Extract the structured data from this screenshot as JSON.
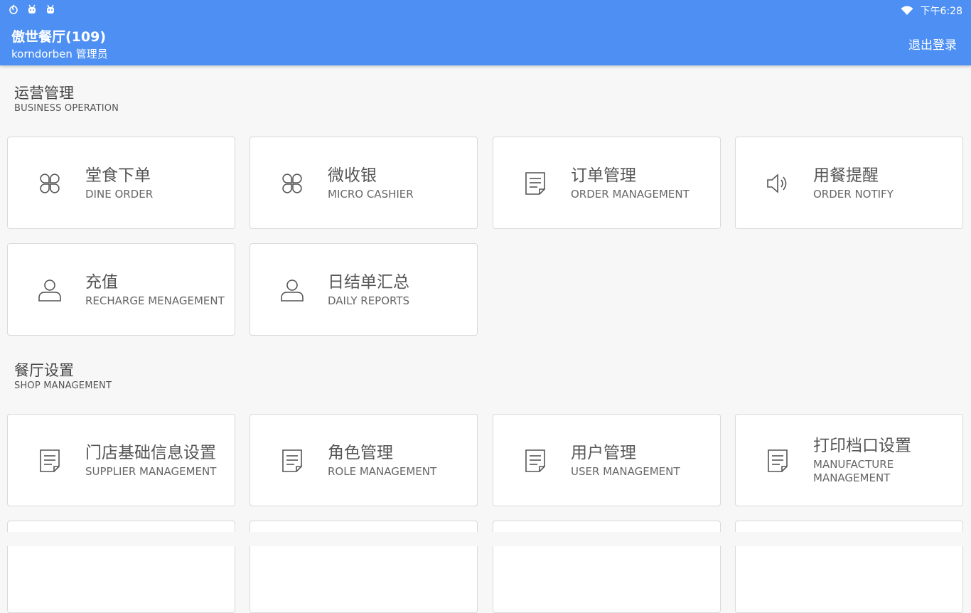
{
  "status_bar": {
    "time": "下午6:28"
  },
  "header": {
    "title": "傲世餐厅(109)",
    "subtitle": "korndorben 管理员",
    "logout_label": "退出登录"
  },
  "sections": {
    "operation": {
      "title_cn": "运营管理",
      "title_en": "BUSINESS OPERATION"
    },
    "shop": {
      "title_cn": "餐厅设置",
      "title_en": "SHOP MANAGEMENT"
    }
  },
  "tiles": {
    "dine_order": {
      "cn": "堂食下单",
      "en": "DINE ORDER",
      "icon": "clover-icon"
    },
    "micro_cashier": {
      "cn": "微收银",
      "en": "MICRO CASHIER",
      "icon": "clover-icon"
    },
    "order_management": {
      "cn": "订单管理",
      "en": "ORDER MANAGEMENT",
      "icon": "document-icon"
    },
    "order_notify": {
      "cn": "用餐提醒",
      "en": "ORDER NOTIFY",
      "icon": "speaker-icon"
    },
    "recharge": {
      "cn": "充值",
      "en": "RECHARGE MENAGEMENT",
      "icon": "user-icon"
    },
    "daily_reports": {
      "cn": "日结单汇总",
      "en": "DAILY REPORTS",
      "icon": "user-icon"
    },
    "store_info": {
      "cn": "门店基础信息设置",
      "en": "SUPPLIER MANAGEMENT",
      "icon": "document-icon"
    },
    "role_management": {
      "cn": "角色管理",
      "en": "ROLE MANAGEMENT",
      "icon": "document-icon"
    },
    "user_management": {
      "cn": "用户管理",
      "en": "USER MANAGEMENT",
      "icon": "document-icon"
    },
    "print_stall": {
      "cn": "打印档口设置",
      "en": "MANUFACTURE\nMANAGEMENT",
      "icon": "document-icon"
    }
  },
  "colors": {
    "appbar": "#4d8ff3",
    "background": "#f7f7f7",
    "tile_border": "#d9d9d9"
  }
}
